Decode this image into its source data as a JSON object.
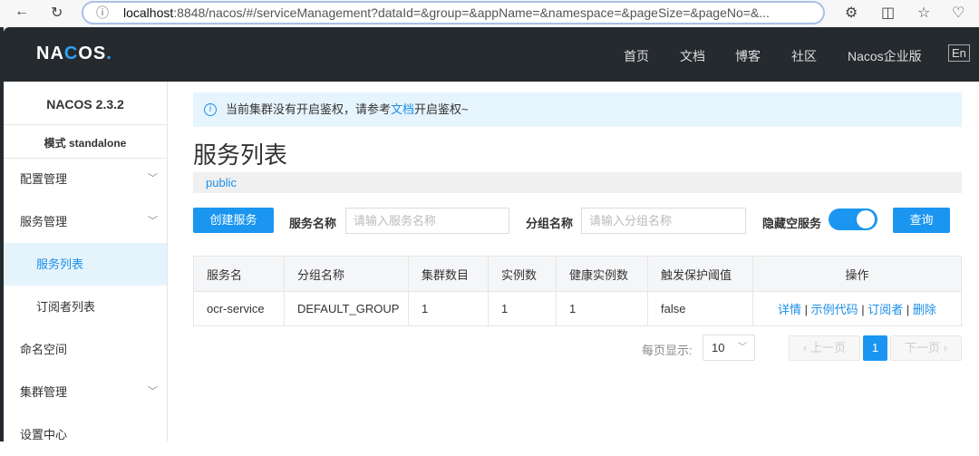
{
  "browser": {
    "url_host": "localhost",
    "url_rest": ":8848/nacos/#/serviceManagement?dataId=&group=&appName=&namespace=&pageSize=&pageNo=&..."
  },
  "nav": {
    "logo": "NACOS.",
    "items": [
      "首页",
      "文档",
      "博客",
      "社区",
      "Nacos企业版"
    ],
    "lang": "En"
  },
  "sidebar": {
    "version": "NACOS 2.3.2",
    "mode": "模式 standalone",
    "items": [
      {
        "label": "配置管理"
      },
      {
        "label": "服务管理"
      },
      {
        "label": "服务列表"
      },
      {
        "label": "订阅者列表"
      },
      {
        "label": "命名空间"
      },
      {
        "label": "集群管理"
      },
      {
        "label": "设置中心"
      }
    ]
  },
  "notice": {
    "pre": "当前集群没有开启鉴权，请参考",
    "link": "文档",
    "post": "开启鉴权~"
  },
  "title": "服务列表",
  "namespace": "public",
  "filters": {
    "create": "创建服务",
    "service_label": "服务名称",
    "service_placeholder": "请输入服务名称",
    "group_label": "分组名称",
    "group_placeholder": "请输入分组名称",
    "hide_empty": "隐藏空服务",
    "hide_empty_on": true,
    "query": "查询"
  },
  "table": {
    "headers": [
      "服务名",
      "分组名称",
      "集群数目",
      "实例数",
      "健康实例数",
      "触发保护阈值",
      "操作"
    ],
    "rows": [
      {
        "name": "ocr-service",
        "group": "DEFAULT_GROUP",
        "clusters": "1",
        "instances": "1",
        "healthy": "1",
        "threshold": "false",
        "actions": [
          "详情",
          "示例代码",
          "订阅者",
          "删除"
        ]
      }
    ]
  },
  "pagination": {
    "page_size_label": "每页显示:",
    "page_size": "10",
    "prev": "上一页",
    "current": "1",
    "next": "下一页"
  }
}
